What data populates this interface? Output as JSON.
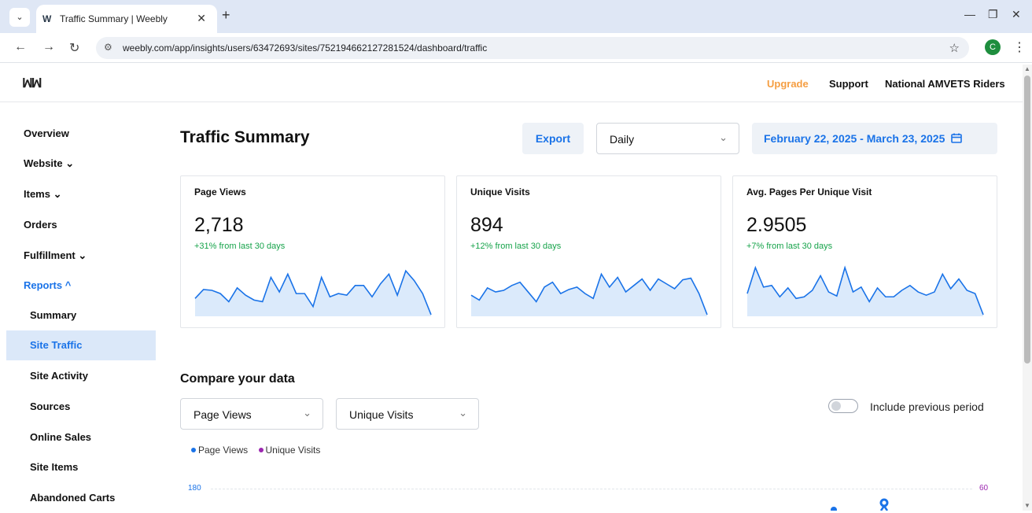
{
  "browser": {
    "tab_title": "Traffic Summary | Weebly",
    "url": "weebly.com/app/insights/users/63472693/sites/752194662127281524/dashboard/traffic",
    "profile_initial": "C",
    "tab_close": "✕",
    "new_tab": "+"
  },
  "header": {
    "upgrade": "Upgrade",
    "support": "Support",
    "site_name": "National AMVETS Riders"
  },
  "sidebar": {
    "items": [
      {
        "label": "Overview"
      },
      {
        "label": "Website ⌄"
      },
      {
        "label": "Items ⌄"
      },
      {
        "label": "Orders"
      },
      {
        "label": "Fulfillment ⌄"
      },
      {
        "label": "Reports ^"
      }
    ],
    "reports_sub": [
      {
        "label": "Summary"
      },
      {
        "label": "Site Traffic"
      },
      {
        "label": "Site Activity"
      },
      {
        "label": "Sources"
      },
      {
        "label": "Online Sales"
      },
      {
        "label": "Site Items"
      },
      {
        "label": "Abandoned Carts"
      }
    ]
  },
  "main": {
    "title": "Traffic Summary",
    "export_label": "Export",
    "period_select": "Daily",
    "date_range": "February 22, 2025 - March 23, 2025"
  },
  "cards": [
    {
      "label": "Page Views",
      "value": "2,718",
      "delta": "+31% from last 30 days",
      "trend": [
        22,
        33,
        32,
        28,
        18,
        35,
        26,
        20,
        18,
        48,
        30,
        52,
        28,
        28,
        12,
        48,
        24,
        28,
        26,
        38,
        38,
        24,
        40,
        52,
        26,
        56,
        44,
        28,
        2
      ]
    },
    {
      "label": "Unique Visits",
      "value": "894",
      "delta": "+12% from last 30 days",
      "trend": [
        26,
        20,
        35,
        30,
        32,
        38,
        42,
        30,
        18,
        36,
        42,
        28,
        33,
        36,
        28,
        22,
        52,
        36,
        48,
        30,
        38,
        46,
        32,
        46,
        40,
        34,
        45,
        47,
        28,
        2
      ]
    },
    {
      "label": "Avg. Pages Per Unique Visit",
      "value": "2.9505",
      "delta": "+7% from last 30 days",
      "trend": [
        28,
        60,
        36,
        38,
        24,
        35,
        22,
        24,
        32,
        50,
        30,
        25,
        60,
        30,
        36,
        18,
        35,
        24,
        24,
        32,
        38,
        30,
        26,
        30,
        52,
        34,
        46,
        32,
        28,
        2
      ]
    }
  ],
  "compare": {
    "title": "Compare your data",
    "metric_a": "Page Views",
    "metric_b": "Unique Visits",
    "toggle_label": "Include previous period",
    "toggle_on": false,
    "legend_a": "Page Views",
    "legend_b": "Unique Visits",
    "axis_left_top": "180",
    "axis_right_top": "60",
    "color_a": "#1a73e8",
    "color_b": "#9c27b0"
  },
  "icons": {
    "chevron": "⌄",
    "calendar": "calendar-icon"
  }
}
